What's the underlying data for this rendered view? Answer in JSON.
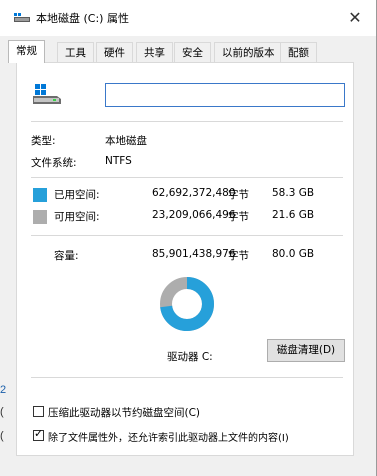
{
  "window": {
    "title": "本地磁盘 (C:) 属性"
  },
  "tabs": [
    {
      "label": "常规"
    },
    {
      "label": "工具"
    },
    {
      "label": "硬件"
    },
    {
      "label": "共享"
    },
    {
      "label": "安全"
    },
    {
      "label": "以前的版本"
    },
    {
      "label": "配额"
    }
  ],
  "general": {
    "name_value": "",
    "type_label": "类型:",
    "type_value": "本地磁盘",
    "fs_label": "文件系统:",
    "fs_value": "NTFS",
    "used": {
      "label": "已用空间:",
      "bytes": "62,692,372,480",
      "unit": "字节",
      "gb": "58.3 GB",
      "color": "#26a0da"
    },
    "free": {
      "label": "可用空间:",
      "bytes": "23,209,066,496",
      "unit": "字节",
      "gb": "21.6 GB",
      "color": "#adadad"
    },
    "capacity": {
      "label": "容量:",
      "bytes": "85,901,438,976",
      "unit": "字节",
      "gb": "80.0 GB"
    },
    "drive_label": "驱动器 C:",
    "used_fraction": 0.7298,
    "cleanup_button": "磁盘清理(D)",
    "compress_checkbox": {
      "label": "压缩此驱动器以节约磁盘空间(C)",
      "checked": false
    },
    "index_checkbox": {
      "label": "除了文件属性外，还允许索引此驱动器上文件的内容(I)",
      "checked": true
    }
  },
  "background": {
    "text_a": "2",
    "text_b": "(",
    "text_c": "("
  },
  "icons": {
    "title": "drive-icon",
    "big": "drive-icon",
    "close": "close-icon"
  }
}
